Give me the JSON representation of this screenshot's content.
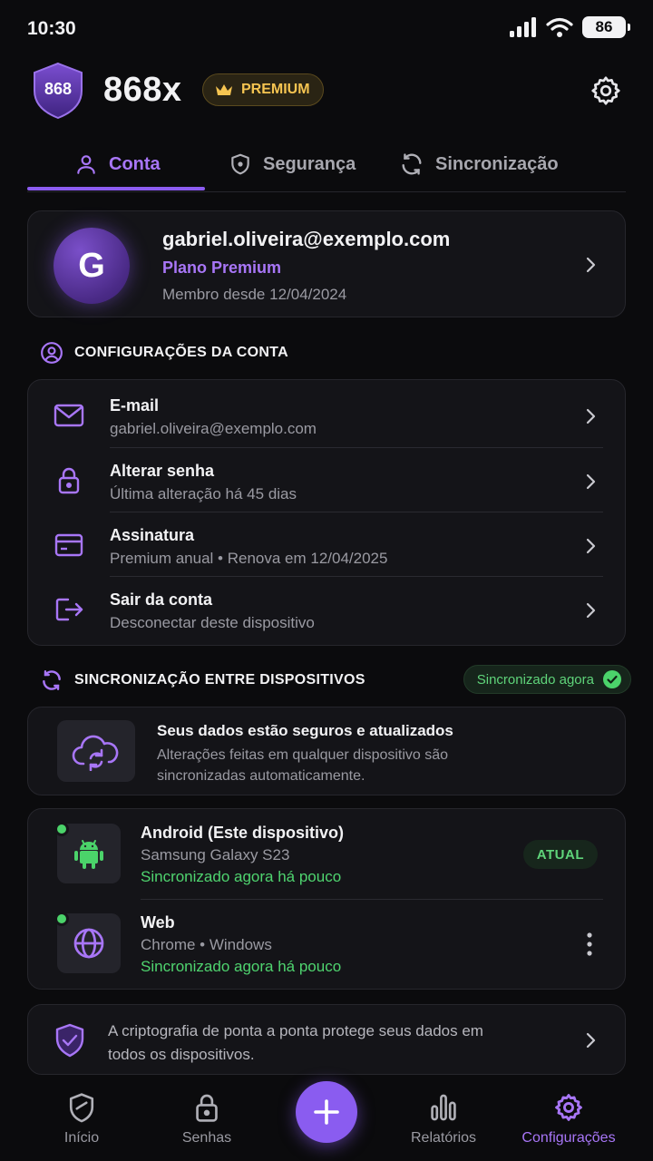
{
  "status_bar": {
    "time": "10:30",
    "battery": "86"
  },
  "header": {
    "logo_text": "868",
    "brand": "868x",
    "premium_label": "PREMIUM"
  },
  "tabs": [
    {
      "label": "Conta",
      "active": true
    },
    {
      "label": "Segurança",
      "active": false
    },
    {
      "label": "Sincronização",
      "active": false
    }
  ],
  "profile": {
    "initial": "G",
    "email": "gabriel.oliveira@exemplo.com",
    "plan": "Plano Premium",
    "member_since": "Membro desde 12/04/2024"
  },
  "account_section": {
    "title": "CONFIGURAÇÕES DA CONTA",
    "items": [
      {
        "title": "E-mail",
        "subtitle": "gabriel.oliveira@exemplo.com",
        "icon": "mail-icon"
      },
      {
        "title": "Alterar senha",
        "subtitle": "Última alteração há 45 dias",
        "icon": "lock-icon"
      },
      {
        "title": "Assinatura",
        "subtitle": "Premium anual • Renova em 12/04/2025",
        "icon": "credit-card-icon"
      },
      {
        "title": "Sair da conta",
        "subtitle": "Desconectar deste dispositivo",
        "icon": "logout-icon"
      }
    ]
  },
  "sync_section": {
    "title": "SINCRONIZAÇÃO ENTRE DISPOSITIVOS",
    "badge": "Sincronizado agora",
    "info_title": "Seus dados estão seguros e atualizados",
    "info_text": "Alterações feitas em qualquer dispositivo são sincronizadas automaticamente.",
    "devices": [
      {
        "name": "Android (Este dispositivo)",
        "model": "Samsung Galaxy S23",
        "status": "Sincronizado agora há pouco",
        "tag": "ATUAL",
        "icon": "android-icon"
      },
      {
        "name": "Web",
        "model": "Chrome • Windows",
        "status": "Sincronizado agora há pouco",
        "icon": "globe-icon"
      }
    ]
  },
  "encryption_note": "A criptografia de ponta a ponta protege seus dados em todos os dispositivos.",
  "bottom_nav": [
    {
      "label": "Início",
      "icon": "shield-icon"
    },
    {
      "label": "Senhas",
      "icon": "lock-icon"
    },
    {
      "label": "Relatórios",
      "icon": "bar-chart-icon"
    },
    {
      "label": "Configurações",
      "icon": "gear-icon",
      "active": true
    }
  ],
  "colors": {
    "accent": "#8c5cf0",
    "premium": "#f5c451",
    "success": "#4fd46f",
    "background": "#0b0b0d",
    "card": "#141418"
  }
}
